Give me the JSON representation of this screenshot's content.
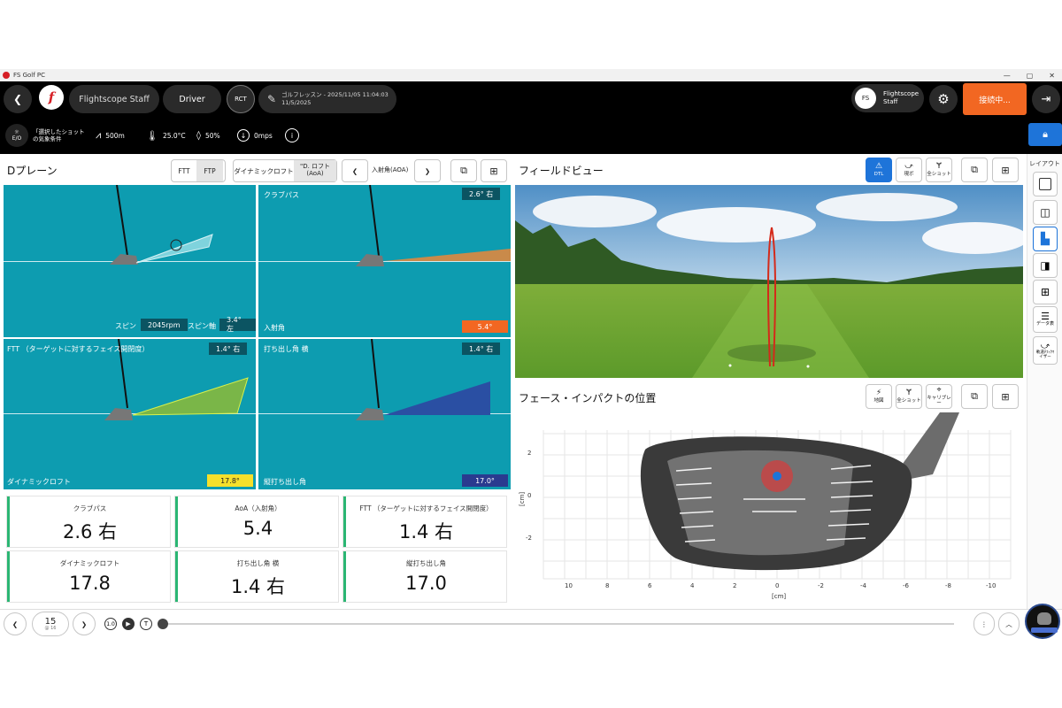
{
  "window": {
    "title": "FS Golf PC"
  },
  "topbar": {
    "user_tab": "Flightscope Staff",
    "club_tab": "Driver",
    "session_label": "ゴルフレッスン - 2025/11/05 11:04:03",
    "session_date": "11/5/2025",
    "avatar_initials": "FS",
    "profile_name_line1": "Flightscope",
    "profile_name_line2": "Staff",
    "connect_label": "接続中...",
    "rct_label": "RCT"
  },
  "conditions": {
    "weather_label_line1": "「選択したショット",
    "weather_label_line2": "の気象条件",
    "eo_label": "E/O",
    "altitude": "500m",
    "temperature": "25.0°C",
    "humidity": "50%",
    "wind": "0mps"
  },
  "dplane": {
    "title": "Dプレーン",
    "ftt_button": "FTT",
    "ftp_button": "FTP",
    "dyn_loft_button": "ダイナミックロフト",
    "dloft_select_line1": "\"D. ロフト",
    "dloft_select_line2": "(AoA)",
    "aoa_label": "入射角(AOA)",
    "tiles": {
      "t1": {
        "spin_label": "スピン",
        "spin_value": "2045rpm",
        "spin_axis_label": "スピン軸",
        "spin_axis_value": "3.4° 左"
      },
      "t2": {
        "top_label": "クラブパス",
        "top_value": "2.6° 右",
        "bottom_label": "入射角",
        "bottom_value": "5.4°"
      },
      "t3": {
        "top_label": "FTT （ターゲットに対するフェイス開閉度）",
        "top_value": "1.4° 右",
        "bottom_label": "ダイナミックロフト",
        "bottom_value": "17.8°"
      },
      "t4": {
        "top_label": "打ち出し角 横",
        "top_value": "1.4° 右",
        "bottom_label": "縦打ち出し角",
        "bottom_value": "17.0°"
      }
    },
    "metrics": [
      {
        "label": "クラブパス",
        "value": "2.6 右"
      },
      {
        "label": "AoA（入射角）",
        "value": "5.4"
      },
      {
        "label": "FTT （ターゲットに対するフェイス開閉度）",
        "value": "1.4 右"
      },
      {
        "label": "ダイナミックロフト",
        "value": "17.8"
      },
      {
        "label": "打ち出し角 横",
        "value": "1.4 右"
      },
      {
        "label": "縦打ち出し角",
        "value": "17.0"
      }
    ]
  },
  "field_view": {
    "title": "フィールドビュー",
    "dtl_label": "DTL",
    "btn2_label": "現ボ",
    "btn3_label": "全ショット"
  },
  "impact": {
    "title": "フェース・インパクトの位置",
    "btn1_label": "地図",
    "btn2_label": "全ショット",
    "btn3_label": "キャリブレー",
    "y_ticks": [
      "2",
      "0",
      "-2"
    ],
    "x_ticks": [
      "10",
      "8",
      "6",
      "4",
      "2",
      "0",
      "-2",
      "-4",
      "-6",
      "-8",
      "-10"
    ],
    "axis_unit_x": "[cm]",
    "axis_unit_y": "[cm]"
  },
  "rightbar": {
    "title": "レイアウト",
    "data_label": "データ表",
    "anim_label_line1": "軌道ﾁﾌｨｸﾏ",
    "anim_label_line2": "イザー"
  },
  "footer": {
    "shot_number": "15",
    "shot_sub": "@ 16",
    "speed_label": "1.0",
    "t_label": "T"
  },
  "colors": {
    "accent_blue": "#1e74d9",
    "orange": "#f26722",
    "tile_teal": "#0d9cb0",
    "metric_green": "#2bb673"
  }
}
